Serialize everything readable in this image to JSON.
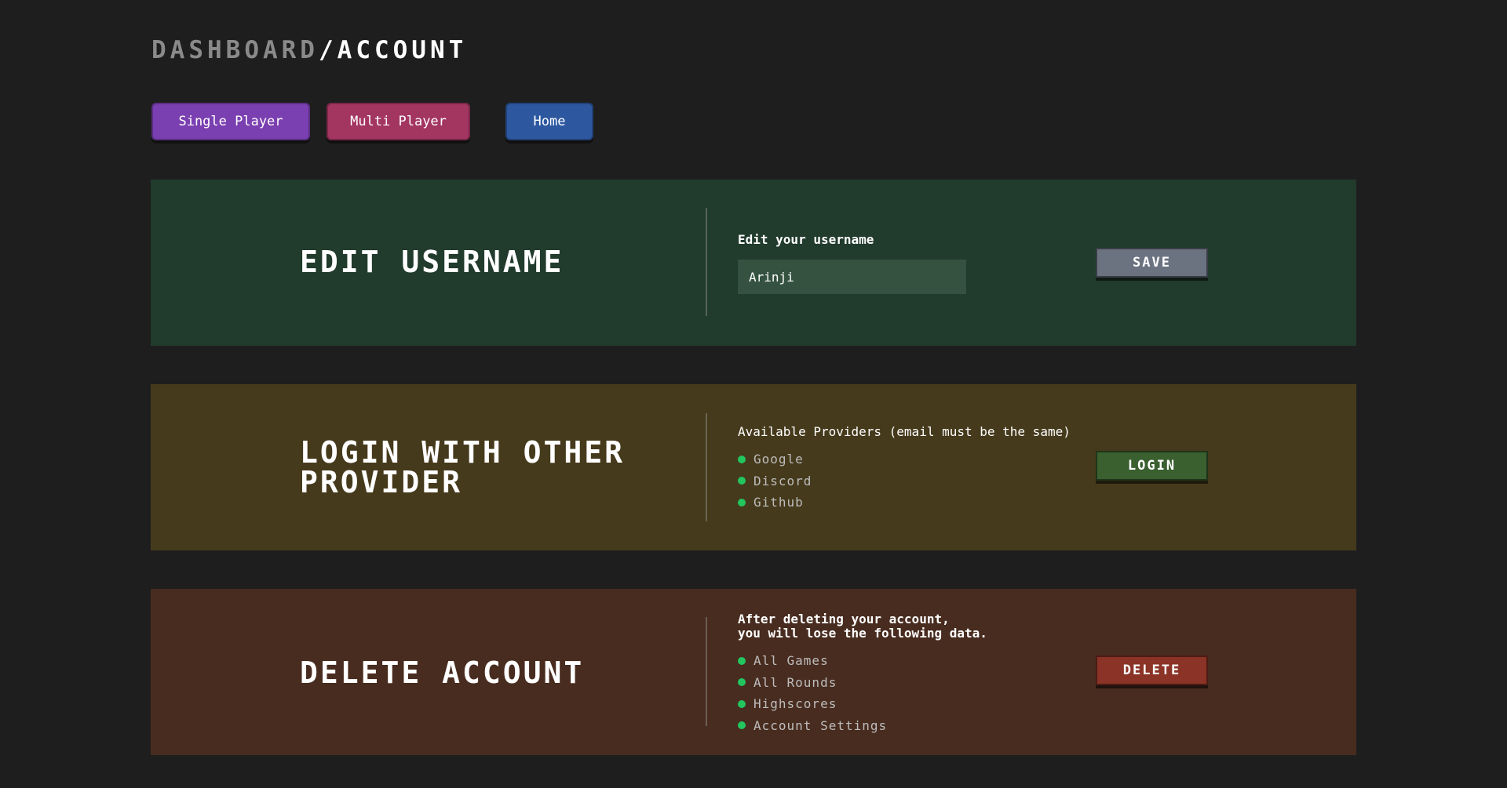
{
  "breadcrumb": {
    "parent": "DASHBOARD",
    "separator": "/",
    "current": "ACCOUNT"
  },
  "nav": {
    "buttons": [
      {
        "label": "Single Player",
        "color": "#7a3fb0"
      },
      {
        "label": "Multi Player",
        "color": "#a33561"
      },
      {
        "label": "Home",
        "color": "#2d58a0"
      }
    ]
  },
  "panels": {
    "edit_username": {
      "title": "EDIT USERNAME",
      "bg": "#213b2d",
      "field_label": "Edit your username",
      "input_value": "Arinji",
      "button_label": "SAVE",
      "button_color": "#6b7280"
    },
    "login_provider": {
      "title_line1": "LOGIN WITH OTHER",
      "title_line2": "PROVIDER",
      "bg": "#463a1c",
      "label": "Available Providers (email must be the same)",
      "providers": [
        "Google",
        "Discord",
        "Github"
      ],
      "button_label": "LOGIN",
      "button_color": "#3a6030"
    },
    "delete_account": {
      "title": "DELETE ACCOUNT",
      "bg": "#482c1f",
      "warning_line1": "After deleting your account,",
      "warning_line2": "you will lose the following data.",
      "items": [
        "All Games",
        "All Rounds",
        "Highscores",
        "Account Settings"
      ],
      "button_label": "DELETE",
      "button_color": "#8a3326"
    }
  },
  "colors": {
    "page_bg": "#1e1e1e",
    "bullet": "#22c55e"
  }
}
